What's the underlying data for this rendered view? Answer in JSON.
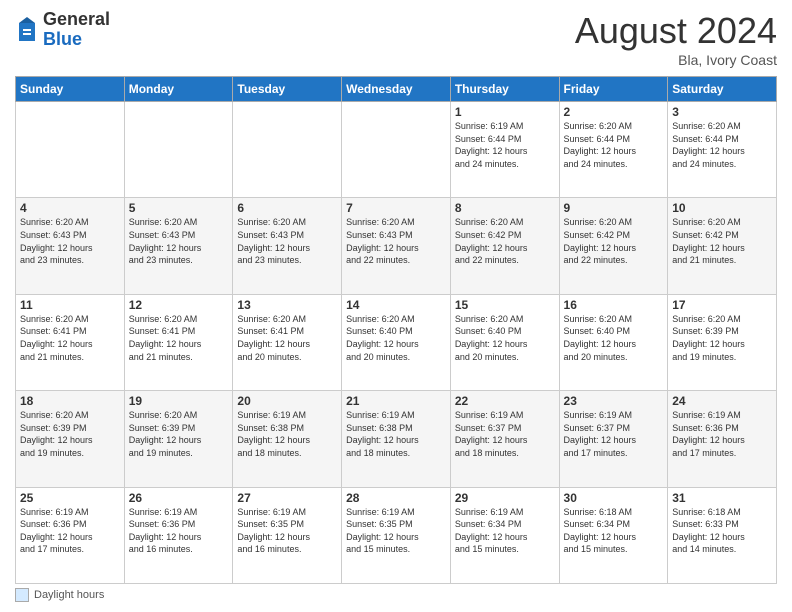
{
  "header": {
    "logo_general": "General",
    "logo_blue": "Blue",
    "month_title": "August 2024",
    "location": "Bla, Ivory Coast"
  },
  "days_of_week": [
    "Sunday",
    "Monday",
    "Tuesday",
    "Wednesday",
    "Thursday",
    "Friday",
    "Saturday"
  ],
  "footer": {
    "label": "Daylight hours"
  },
  "weeks": [
    [
      {
        "day": "",
        "info": ""
      },
      {
        "day": "",
        "info": ""
      },
      {
        "day": "",
        "info": ""
      },
      {
        "day": "",
        "info": ""
      },
      {
        "day": "1",
        "info": "Sunrise: 6:19 AM\nSunset: 6:44 PM\nDaylight: 12 hours\nand 24 minutes."
      },
      {
        "day": "2",
        "info": "Sunrise: 6:20 AM\nSunset: 6:44 PM\nDaylight: 12 hours\nand 24 minutes."
      },
      {
        "day": "3",
        "info": "Sunrise: 6:20 AM\nSunset: 6:44 PM\nDaylight: 12 hours\nand 24 minutes."
      }
    ],
    [
      {
        "day": "4",
        "info": "Sunrise: 6:20 AM\nSunset: 6:43 PM\nDaylight: 12 hours\nand 23 minutes."
      },
      {
        "day": "5",
        "info": "Sunrise: 6:20 AM\nSunset: 6:43 PM\nDaylight: 12 hours\nand 23 minutes."
      },
      {
        "day": "6",
        "info": "Sunrise: 6:20 AM\nSunset: 6:43 PM\nDaylight: 12 hours\nand 23 minutes."
      },
      {
        "day": "7",
        "info": "Sunrise: 6:20 AM\nSunset: 6:43 PM\nDaylight: 12 hours\nand 22 minutes."
      },
      {
        "day": "8",
        "info": "Sunrise: 6:20 AM\nSunset: 6:42 PM\nDaylight: 12 hours\nand 22 minutes."
      },
      {
        "day": "9",
        "info": "Sunrise: 6:20 AM\nSunset: 6:42 PM\nDaylight: 12 hours\nand 22 minutes."
      },
      {
        "day": "10",
        "info": "Sunrise: 6:20 AM\nSunset: 6:42 PM\nDaylight: 12 hours\nand 21 minutes."
      }
    ],
    [
      {
        "day": "11",
        "info": "Sunrise: 6:20 AM\nSunset: 6:41 PM\nDaylight: 12 hours\nand 21 minutes."
      },
      {
        "day": "12",
        "info": "Sunrise: 6:20 AM\nSunset: 6:41 PM\nDaylight: 12 hours\nand 21 minutes."
      },
      {
        "day": "13",
        "info": "Sunrise: 6:20 AM\nSunset: 6:41 PM\nDaylight: 12 hours\nand 20 minutes."
      },
      {
        "day": "14",
        "info": "Sunrise: 6:20 AM\nSunset: 6:40 PM\nDaylight: 12 hours\nand 20 minutes."
      },
      {
        "day": "15",
        "info": "Sunrise: 6:20 AM\nSunset: 6:40 PM\nDaylight: 12 hours\nand 20 minutes."
      },
      {
        "day": "16",
        "info": "Sunrise: 6:20 AM\nSunset: 6:40 PM\nDaylight: 12 hours\nand 20 minutes."
      },
      {
        "day": "17",
        "info": "Sunrise: 6:20 AM\nSunset: 6:39 PM\nDaylight: 12 hours\nand 19 minutes."
      }
    ],
    [
      {
        "day": "18",
        "info": "Sunrise: 6:20 AM\nSunset: 6:39 PM\nDaylight: 12 hours\nand 19 minutes."
      },
      {
        "day": "19",
        "info": "Sunrise: 6:20 AM\nSunset: 6:39 PM\nDaylight: 12 hours\nand 19 minutes."
      },
      {
        "day": "20",
        "info": "Sunrise: 6:19 AM\nSunset: 6:38 PM\nDaylight: 12 hours\nand 18 minutes."
      },
      {
        "day": "21",
        "info": "Sunrise: 6:19 AM\nSunset: 6:38 PM\nDaylight: 12 hours\nand 18 minutes."
      },
      {
        "day": "22",
        "info": "Sunrise: 6:19 AM\nSunset: 6:37 PM\nDaylight: 12 hours\nand 18 minutes."
      },
      {
        "day": "23",
        "info": "Sunrise: 6:19 AM\nSunset: 6:37 PM\nDaylight: 12 hours\nand 17 minutes."
      },
      {
        "day": "24",
        "info": "Sunrise: 6:19 AM\nSunset: 6:36 PM\nDaylight: 12 hours\nand 17 minutes."
      }
    ],
    [
      {
        "day": "25",
        "info": "Sunrise: 6:19 AM\nSunset: 6:36 PM\nDaylight: 12 hours\nand 17 minutes."
      },
      {
        "day": "26",
        "info": "Sunrise: 6:19 AM\nSunset: 6:36 PM\nDaylight: 12 hours\nand 16 minutes."
      },
      {
        "day": "27",
        "info": "Sunrise: 6:19 AM\nSunset: 6:35 PM\nDaylight: 12 hours\nand 16 minutes."
      },
      {
        "day": "28",
        "info": "Sunrise: 6:19 AM\nSunset: 6:35 PM\nDaylight: 12 hours\nand 15 minutes."
      },
      {
        "day": "29",
        "info": "Sunrise: 6:19 AM\nSunset: 6:34 PM\nDaylight: 12 hours\nand 15 minutes."
      },
      {
        "day": "30",
        "info": "Sunrise: 6:18 AM\nSunset: 6:34 PM\nDaylight: 12 hours\nand 15 minutes."
      },
      {
        "day": "31",
        "info": "Sunrise: 6:18 AM\nSunset: 6:33 PM\nDaylight: 12 hours\nand 14 minutes."
      }
    ]
  ]
}
